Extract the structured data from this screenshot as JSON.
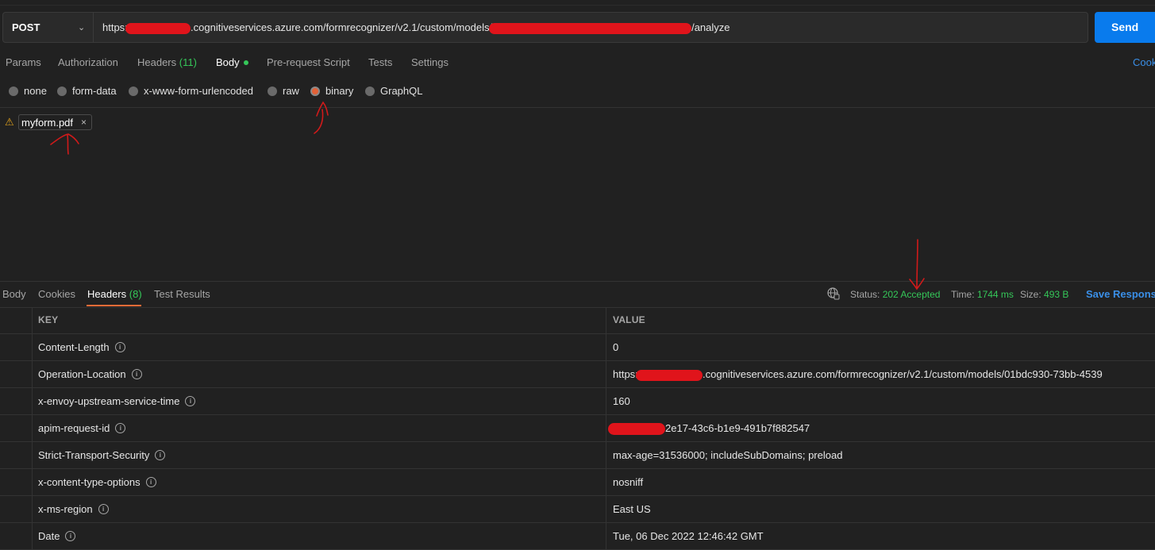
{
  "request": {
    "method": "POST",
    "url_prefix": "https://",
    "url_mid": ".cognitiveservices.azure.com/formrecognizer/v2.1/custom/models/",
    "url_suffix": "/analyze",
    "send_label": "Send"
  },
  "request_tabs": [
    {
      "label": "Params"
    },
    {
      "label": "Authorization"
    },
    {
      "label": "Headers",
      "count": "(11)"
    },
    {
      "label": "Body"
    },
    {
      "label": "Pre-request Script"
    },
    {
      "label": "Tests"
    },
    {
      "label": "Settings"
    }
  ],
  "cookies_link": "Cook",
  "body_types": [
    "none",
    "form-data",
    "x-www-form-urlencoded",
    "raw",
    "binary",
    "GraphQL"
  ],
  "selected_body_type": "binary",
  "file_chip": {
    "name": "myform.pdf",
    "close": "×",
    "warning_icon": "⚠"
  },
  "response_tabs": [
    {
      "label": "Body"
    },
    {
      "label": "Cookies"
    },
    {
      "label": "Headers",
      "count": "(8)"
    },
    {
      "label": "Test Results"
    }
  ],
  "response_meta": {
    "status_label": "Status:",
    "status_value": "202 Accepted",
    "time_label": "Time:",
    "time_value": "1744 ms",
    "size_label": "Size:",
    "size_value": "493 B",
    "save_label": "Save Response"
  },
  "headers_table": {
    "columns": [
      "KEY",
      "VALUE"
    ],
    "rows": [
      {
        "key": "Content-Length",
        "value": "0"
      },
      {
        "key": "Operation-Location",
        "value_prefix": "https://",
        "value": ".cognitiveservices.azure.com/formrecognizer/v2.1/custom/models/01bdc930-73bb-4539"
      },
      {
        "key": "x-envoy-upstream-service-time",
        "value": "160"
      },
      {
        "key": "apim-request-id",
        "value": "2e17-43c6-b1e9-491b7f882547"
      },
      {
        "key": "Strict-Transport-Security",
        "value": "max-age=31536000; includeSubDomains; preload"
      },
      {
        "key": "x-content-type-options",
        "value": "nosniff"
      },
      {
        "key": "x-ms-region",
        "value": "East US"
      },
      {
        "key": "Date",
        "value": "Tue, 06 Dec 2022 12:46:42 GMT"
      }
    ]
  },
  "colors": {
    "accent": "#ff6c37",
    "send": "#097bed",
    "status_ok": "#35c759",
    "link": "#3a8fe8",
    "redaction": "#e0141b"
  }
}
